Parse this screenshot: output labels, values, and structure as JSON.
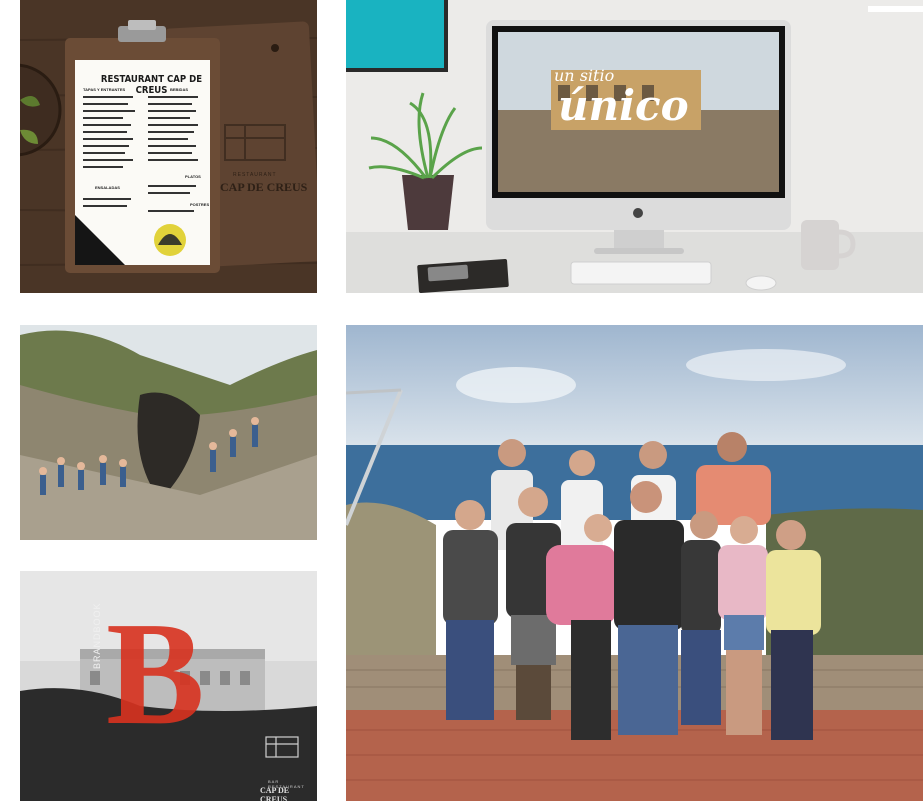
{
  "menu_mockup": {
    "title": "RESTAURANT CAP DE CREUS",
    "section_left": "TAPAS Y ENTRANTES",
    "section_right": "BEBIDAS",
    "section_left2": "ENSALADAS",
    "section_right2": "PLATOS",
    "section_right3": "POSTRES",
    "board_brand_small": "RESTAURANT",
    "board_brand": "CAP DE CREUS"
  },
  "monitor_mockup": {
    "script_small": "un sitio",
    "script_big": "único"
  },
  "brandbook": {
    "letter": "B",
    "vertical_word": "BRANDBOOK",
    "logo_small": "BAR RESTAURANT",
    "logo_name": "CAP DE CREUS"
  },
  "colors": {
    "wood": "#5a4232",
    "brand_red": "#d8321f",
    "teal": "#19b3c1",
    "sky": "#c9d9ea",
    "sea": "#3d6f9c",
    "terracotta": "#b4634c"
  }
}
